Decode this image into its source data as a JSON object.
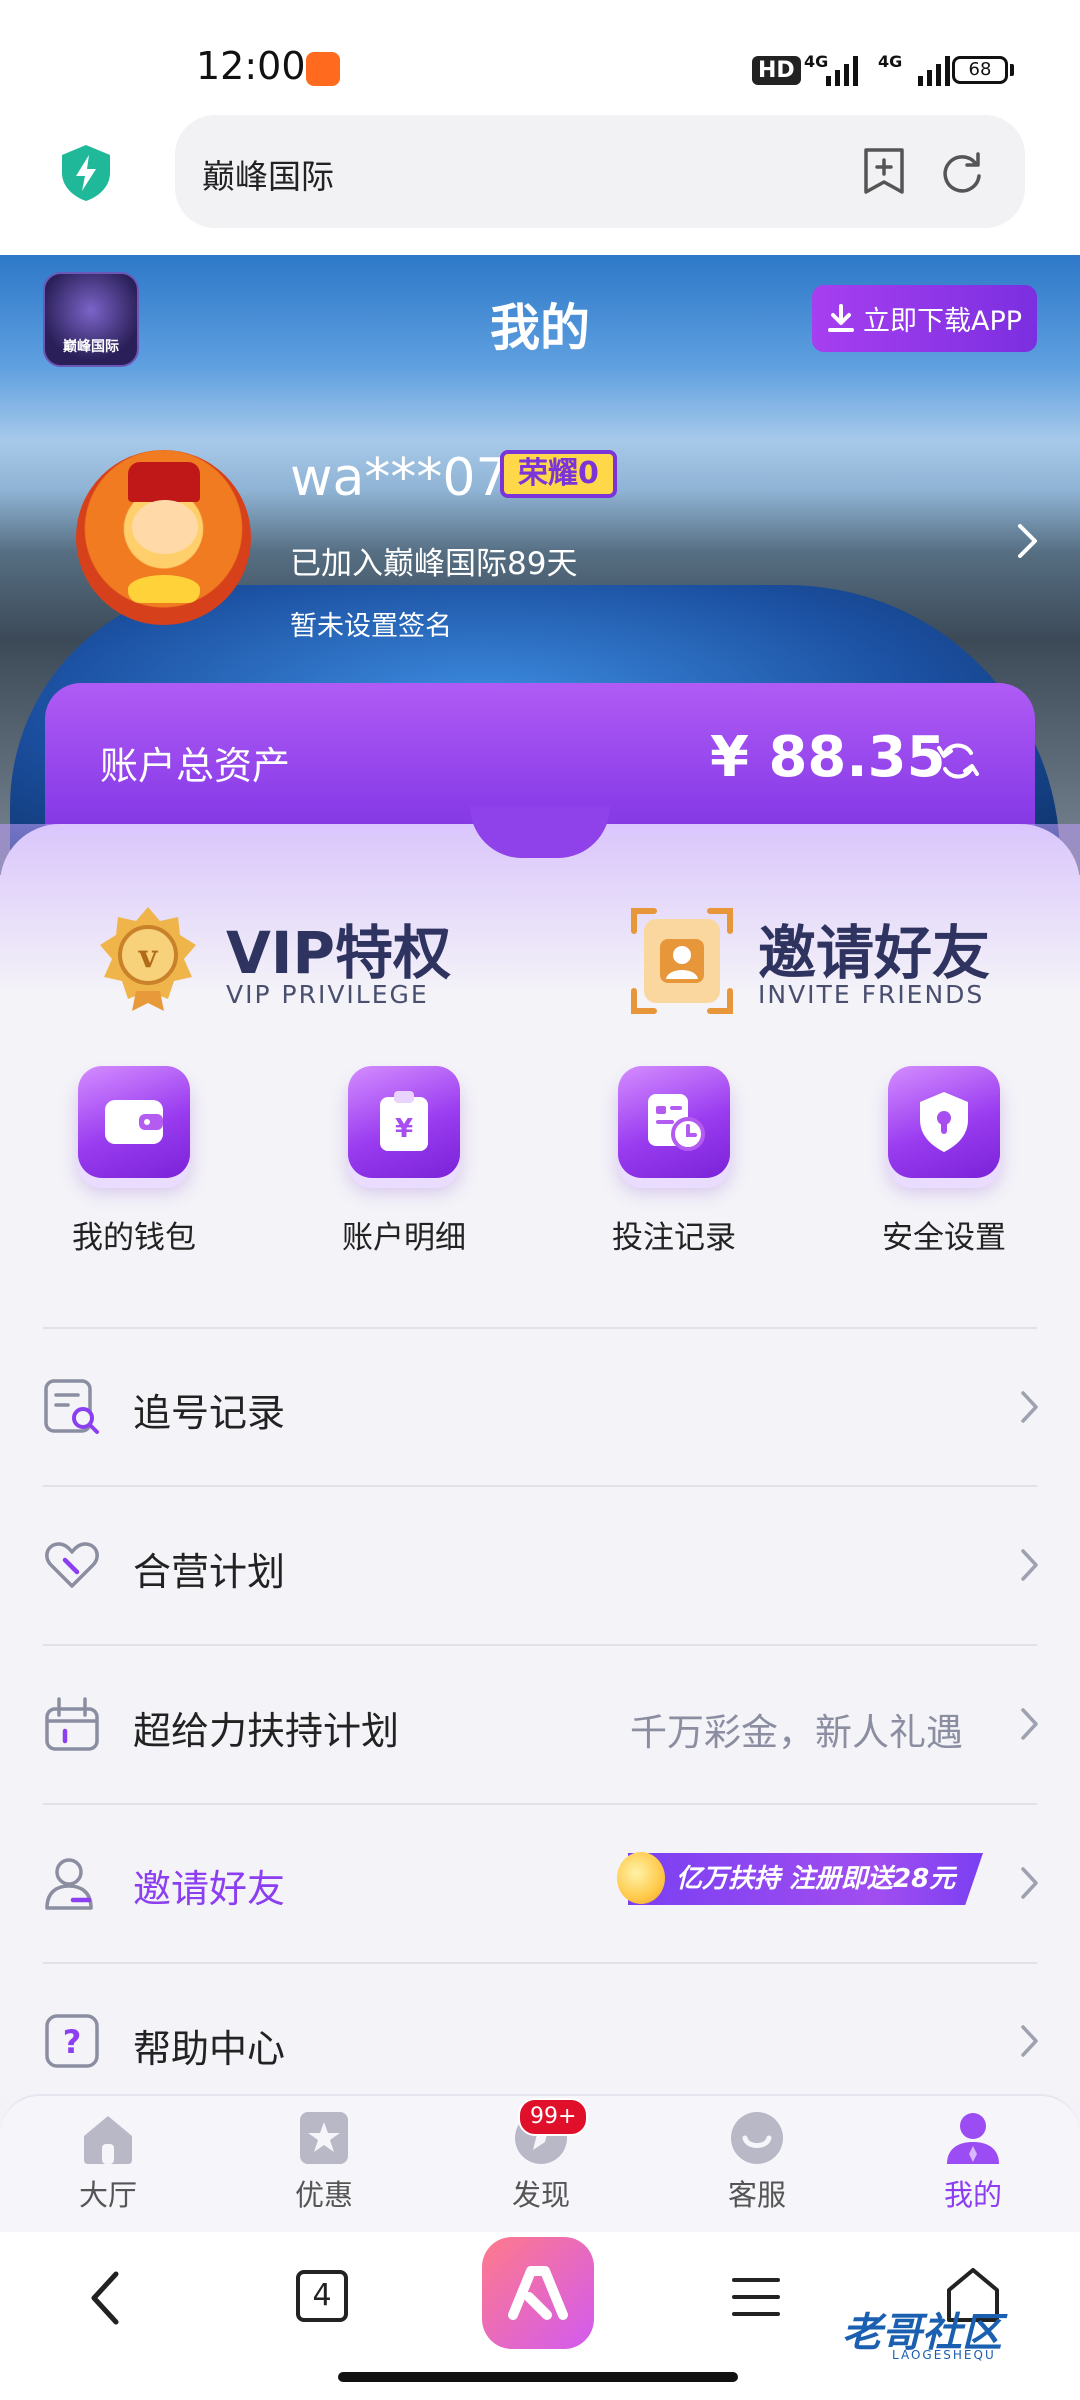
{
  "status_bar": {
    "time": "12:00",
    "hd": "HD",
    "net1": "4G",
    "net2": "4G",
    "battery": "68"
  },
  "browser": {
    "url_text": "巅峰国际"
  },
  "hero": {
    "logo_text": "巅峰国际",
    "title": "我的",
    "download_label": "立即下载APP",
    "username": "wa***07",
    "rank_label": "荣耀0",
    "joined_text": "已加入巅峰国际89天",
    "signature_text": "暂未设置签名"
  },
  "assets": {
    "label": "账户总资产",
    "value": "¥ 88.35"
  },
  "promos": {
    "vip_title": "VIP特权",
    "vip_subtitle": "VIP PRIVILEGE",
    "invite_title": "邀请好友",
    "invite_subtitle": "INVITE FRIENDS"
  },
  "quick_actions": [
    {
      "label": "我的钱包",
      "icon": "wallet-icon"
    },
    {
      "label": "账户明细",
      "icon": "bill-icon"
    },
    {
      "label": "投注记录",
      "icon": "record-icon"
    },
    {
      "label": "安全设置",
      "icon": "shield-icon"
    }
  ],
  "menu": [
    {
      "label": "追号记录",
      "icon": "search-record-icon"
    },
    {
      "label": "合营计划",
      "icon": "heart-icon"
    },
    {
      "label": "超给力扶持计划",
      "icon": "gift-icon",
      "note": "千万彩金，新人礼遇"
    },
    {
      "label": "邀请好友",
      "icon": "user-icon",
      "banner": "亿万扶持 注册即送28元"
    },
    {
      "label": "帮助中心",
      "icon": "help-icon"
    }
  ],
  "tabs": [
    {
      "label": "大厅",
      "icon": "home-icon"
    },
    {
      "label": "优惠",
      "icon": "star-icon"
    },
    {
      "label": "发现",
      "icon": "compass-icon",
      "badge": "99+"
    },
    {
      "label": "客服",
      "icon": "service-icon"
    },
    {
      "label": "我的",
      "icon": "profile-icon",
      "active": true
    }
  ],
  "nav": {
    "tab_count": "4",
    "watermark": "老哥社区",
    "watermark_sub": "LAOGESHEQU"
  },
  "colors": {
    "accent": "#8b3ff0",
    "assets_card": "#9a45ec",
    "badge": "#e0102a"
  }
}
